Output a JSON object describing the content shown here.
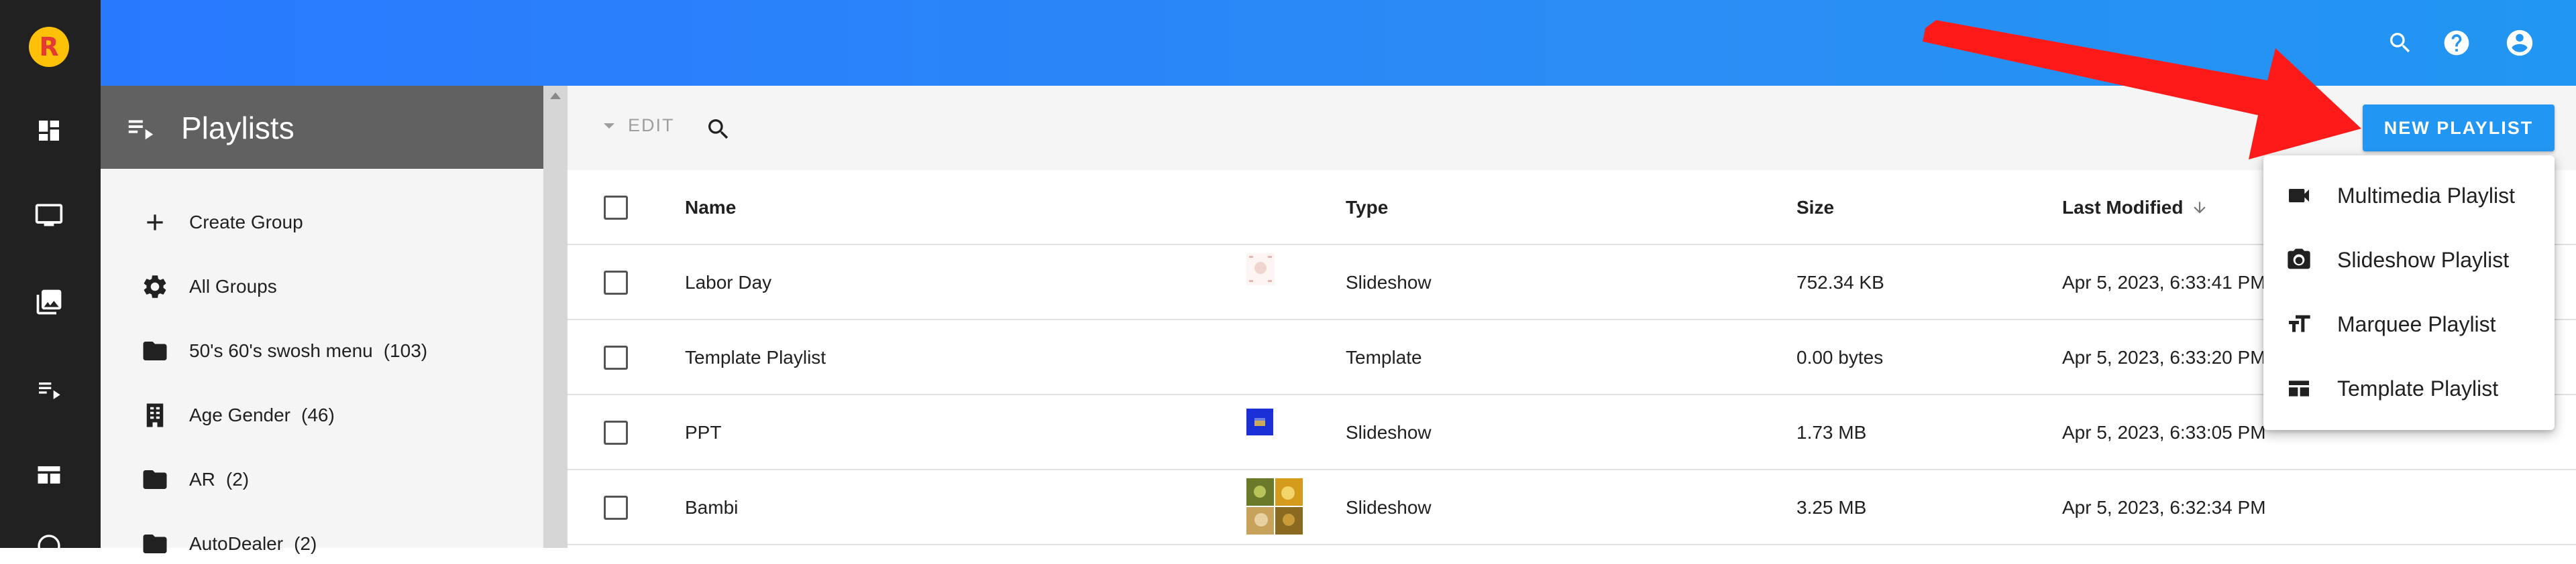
{
  "colors": {
    "topbar": "#2196f3",
    "rail": "#212121",
    "panel_header": "#616161",
    "accent": "#2196f3",
    "annotation_arrow": "#ff1a1a"
  },
  "rail": {
    "logo_letter": "R",
    "items": [
      "dashboard-icon",
      "monitor-icon",
      "media-library-icon",
      "playlist-icon",
      "layout-icon",
      "more-icon"
    ]
  },
  "topbar": {
    "icons": [
      "search-icon",
      "help-icon",
      "account-icon"
    ]
  },
  "panel": {
    "title": "Playlists",
    "items": [
      {
        "icon": "plus-icon",
        "label": "Create Group",
        "count": ""
      },
      {
        "icon": "gear-icon",
        "label": "All Groups",
        "count": ""
      },
      {
        "icon": "folder-icon",
        "label": "50's 60's swosh menu",
        "count": "(103)"
      },
      {
        "icon": "building-icon",
        "label": "Age Gender",
        "count": "(46)"
      },
      {
        "icon": "folder-icon",
        "label": "AR",
        "count": "(2)"
      },
      {
        "icon": "folder-icon",
        "label": "AutoDealer",
        "count": "(2)"
      }
    ]
  },
  "toolbar": {
    "edit_label": "EDIT",
    "new_playlist_label": "NEW PLAYLIST"
  },
  "table": {
    "columns": {
      "name": "Name",
      "type": "Type",
      "size": "Size",
      "last_modified": "Last Modified"
    },
    "rows": [
      {
        "name": "Labor Day",
        "type": "Slideshow",
        "size": "752.34 KB",
        "modified": "Apr 5, 2023, 6:33:41 PM",
        "thumb": "light"
      },
      {
        "name": "Template Playlist",
        "type": "Template",
        "size": "0.00 bytes",
        "modified": "Apr 5, 2023, 6:33:20 PM",
        "thumb": "none"
      },
      {
        "name": "PPT",
        "type": "Slideshow",
        "size": "1.73 MB",
        "modified": "Apr 5, 2023, 6:33:05 PM",
        "thumb": "blue"
      },
      {
        "name": "Bambi",
        "type": "Slideshow",
        "size": "3.25 MB",
        "modified": "Apr 5, 2023, 6:32:34 PM",
        "thumb": "grid"
      }
    ]
  },
  "menu": {
    "items": [
      {
        "icon": "video-camera-icon",
        "label": "Multimedia Playlist"
      },
      {
        "icon": "camera-icon",
        "label": "Slideshow Playlist"
      },
      {
        "icon": "text-size-icon",
        "label": "Marquee Playlist"
      },
      {
        "icon": "template-icon",
        "label": "Template Playlist"
      }
    ]
  }
}
